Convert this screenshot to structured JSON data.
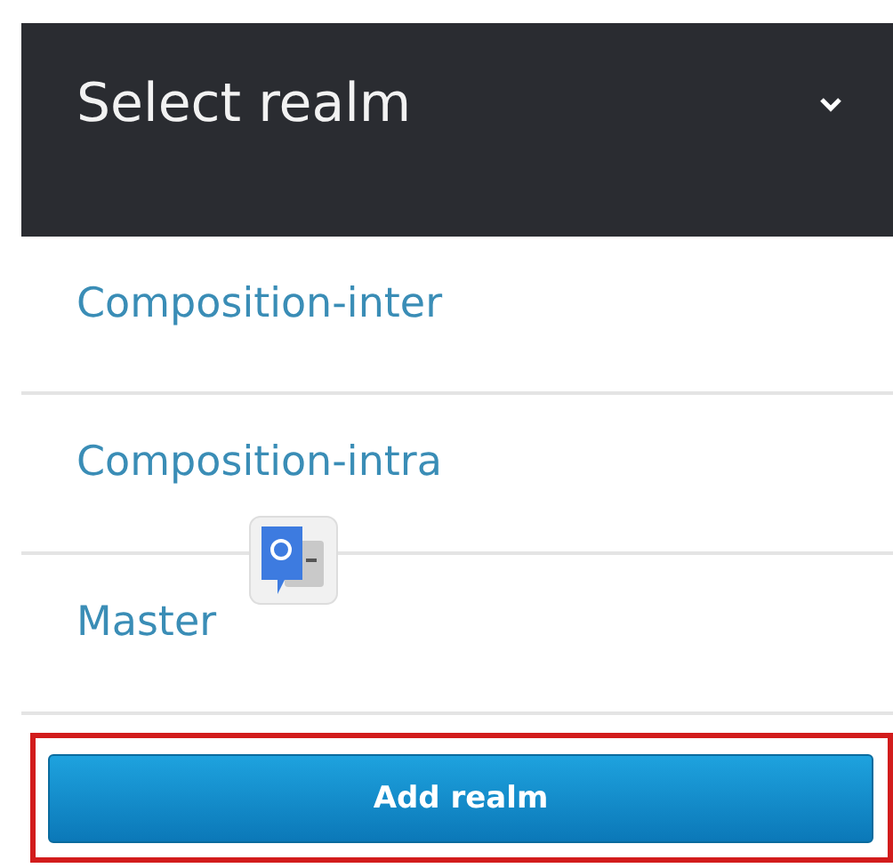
{
  "header": {
    "title": "Select realm"
  },
  "realms": [
    {
      "label": "Composition-inter"
    },
    {
      "label": "Composition-intra"
    },
    {
      "label": "Master"
    }
  ],
  "add_button": {
    "label": "Add realm",
    "highlighted": true
  }
}
